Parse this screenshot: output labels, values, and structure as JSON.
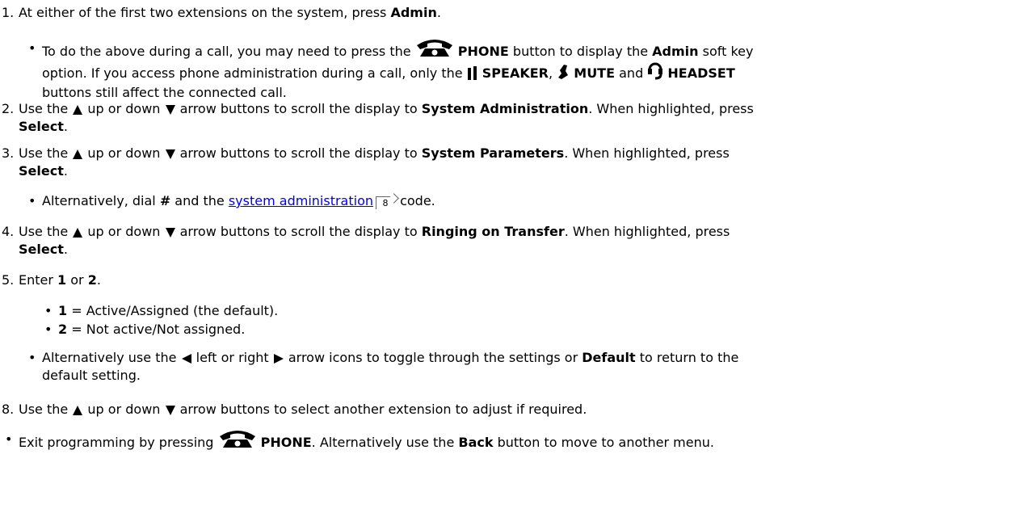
{
  "steps": {
    "s1": {
      "num": "1.",
      "a": "At either of the first two extensions on the system, press ",
      "b": "Admin",
      "c": "."
    },
    "s1_note": {
      "a": "To do the above during a call, you may need to press the ",
      "phone": "PHONE",
      "b": " button to display the ",
      "admin": "Admin",
      "c": " soft key",
      "line2a": "option. If you access phone administration during a call, only the ",
      "speaker": "SPEAKER",
      "sep1": ", ",
      "mute": "MUTE",
      "and": " and ",
      "headset": "HEADSET",
      "line3": "buttons still affect the connected call."
    },
    "s2": {
      "num": "2.",
      "a": "Use the ",
      "b": " up or down ",
      "c": " arrow buttons to scroll the display to ",
      "target": "System Administration",
      "d": ". When highlighted, press",
      "select": "Select",
      "end": "."
    },
    "s3": {
      "num": "3.",
      "a": "Use the ",
      "b": " up or down ",
      "c": " arrow buttons to scroll the display to ",
      "target": "System Parameters",
      "d": ". When highlighted, press",
      "select": "Select",
      "end": "."
    },
    "s3_note": {
      "a": "Alternatively, dial ",
      "hash": "#",
      "b": " and the ",
      "link": "system administration",
      "xref": "8",
      "c": " code."
    },
    "s4": {
      "num": "4.",
      "a": "Use the ",
      "b": " up or down ",
      "c": " arrow buttons to scroll the display to ",
      "target": "Ringing on Transfer",
      "d": ". When highlighted, press",
      "select": "Select",
      "end": "."
    },
    "s5": {
      "num": "5.",
      "a": "Enter ",
      "one": "1",
      "or": " or ",
      "two": "2",
      "end": "."
    },
    "s5_opt1": {
      "k": "1",
      "v": " = Active/Assigned (the default)."
    },
    "s5_opt2": {
      "k": "2",
      "v": " = Not active/Not assigned."
    },
    "s5_note": {
      "a": "Alternatively use the ",
      "b": " left or right ",
      "c": " arrow icons to toggle through the settings or ",
      "default": "Default",
      "d": " to return to the",
      "line2": "default setting."
    },
    "s8": {
      "num": "8.",
      "a": "Use the ",
      "b": " up or down ",
      "c": " arrow buttons to select another extension to adjust if required."
    },
    "exit": {
      "a": "Exit programming by pressing ",
      "phone": "PHONE",
      "b": ". Alternatively use the ",
      "back": "Back",
      "c": " button to move to another menu."
    }
  }
}
